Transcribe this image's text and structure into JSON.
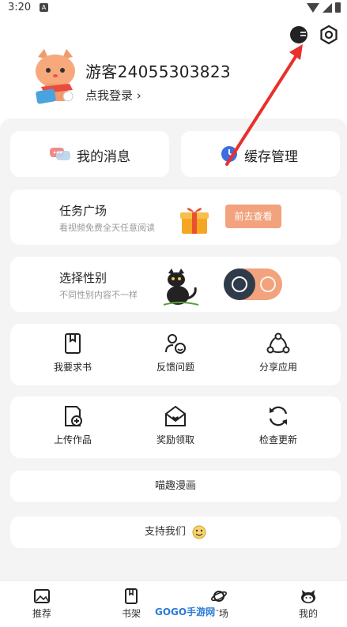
{
  "status_bar": {
    "time": "3:20",
    "notification_letter": "A"
  },
  "profile": {
    "username": "游客24055303823",
    "login_link": "点我登录 ›"
  },
  "quick_actions": {
    "messages": "我的消息",
    "cache": "缓存管理"
  },
  "task_card": {
    "title": "任务广场",
    "subtitle": "看视频免费全天任意阅读",
    "button": "前去查看"
  },
  "gender_card": {
    "title": "选择性别",
    "subtitle": "不同性别内容不一样"
  },
  "grid1": [
    {
      "label": "我要求书",
      "icon": "book-icon"
    },
    {
      "label": "反馈问题",
      "icon": "feedback-icon"
    },
    {
      "label": "分享应用",
      "icon": "share-icon"
    }
  ],
  "grid2": [
    {
      "label": "上传作品",
      "icon": "upload-icon"
    },
    {
      "label": "奖励领取",
      "icon": "reward-icon"
    },
    {
      "label": "检查更新",
      "icon": "refresh-icon"
    }
  ],
  "rows": {
    "about": "喵趣漫画",
    "support": "支持我们"
  },
  "tabs": [
    {
      "label": "推荐",
      "icon": "image-icon"
    },
    {
      "label": "书架",
      "icon": "bookshelf-icon"
    },
    {
      "label": "广场",
      "icon": "planet-icon"
    },
    {
      "label": "我的",
      "icon": "cat-icon"
    }
  ],
  "watermark": "GOGO手游网",
  "colors": {
    "accent": "#f2a27d",
    "arrow": "#e8302c",
    "panel": "#f4f4f4",
    "toggle_knob": "#2f3b4a"
  }
}
